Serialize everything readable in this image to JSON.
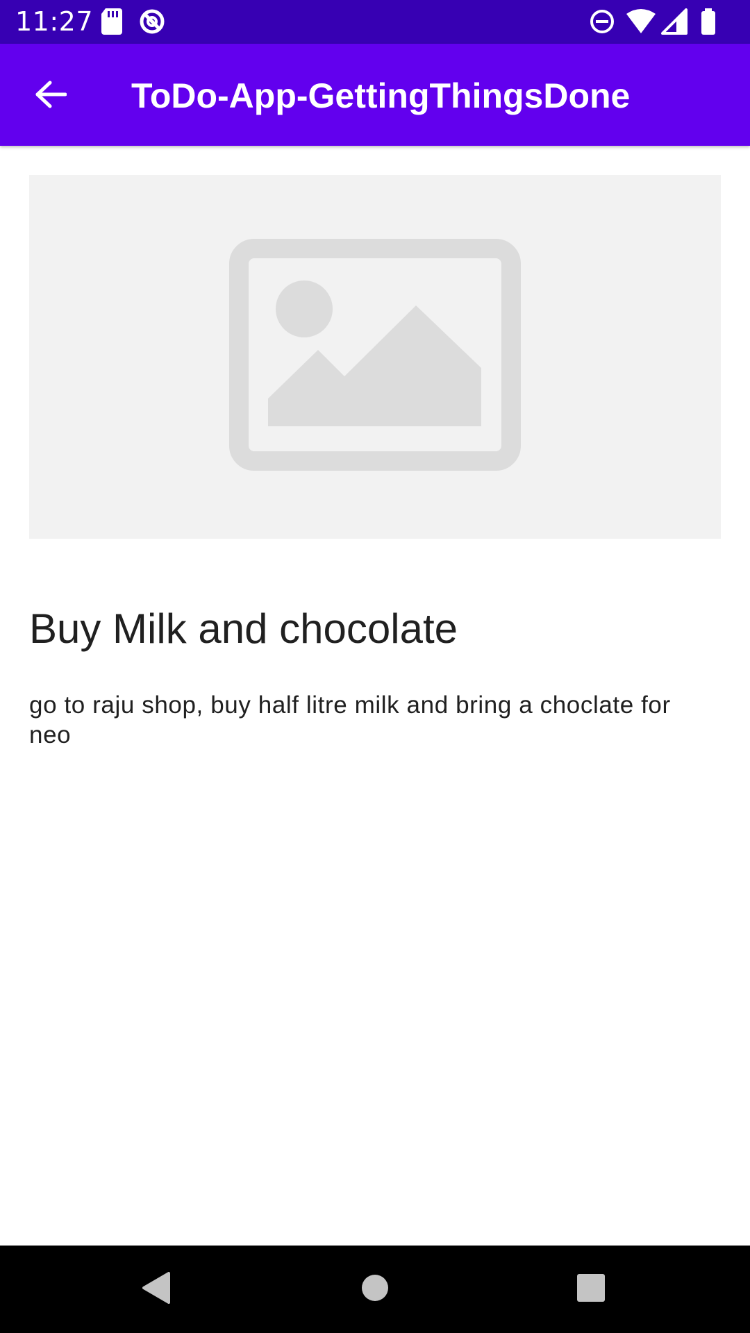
{
  "status_bar": {
    "time": "11:27",
    "left_icons": [
      "sd-card-icon",
      "sync-icon"
    ],
    "right_icons": [
      "do-not-disturb-icon",
      "wifi-icon",
      "signal-icon",
      "battery-icon"
    ]
  },
  "app_bar": {
    "back_icon": "arrow-back-icon",
    "title": "ToDo-App-GettingThingsDone",
    "background": "#6200ee"
  },
  "task": {
    "image_icon": "image-placeholder-icon",
    "title": "Buy Milk and chocolate",
    "description": "go to raju shop, buy half litre milk and bring a choclate for neo"
  },
  "nav_bar": {
    "buttons": [
      "back-triangle-icon",
      "home-circle-icon",
      "recents-square-icon"
    ]
  },
  "colors": {
    "status_bar": "#3700b3",
    "app_bar": "#6200ee",
    "text": "#202020",
    "placeholder_bg": "#f2f2f2",
    "placeholder_icon": "#dcdcdc"
  }
}
